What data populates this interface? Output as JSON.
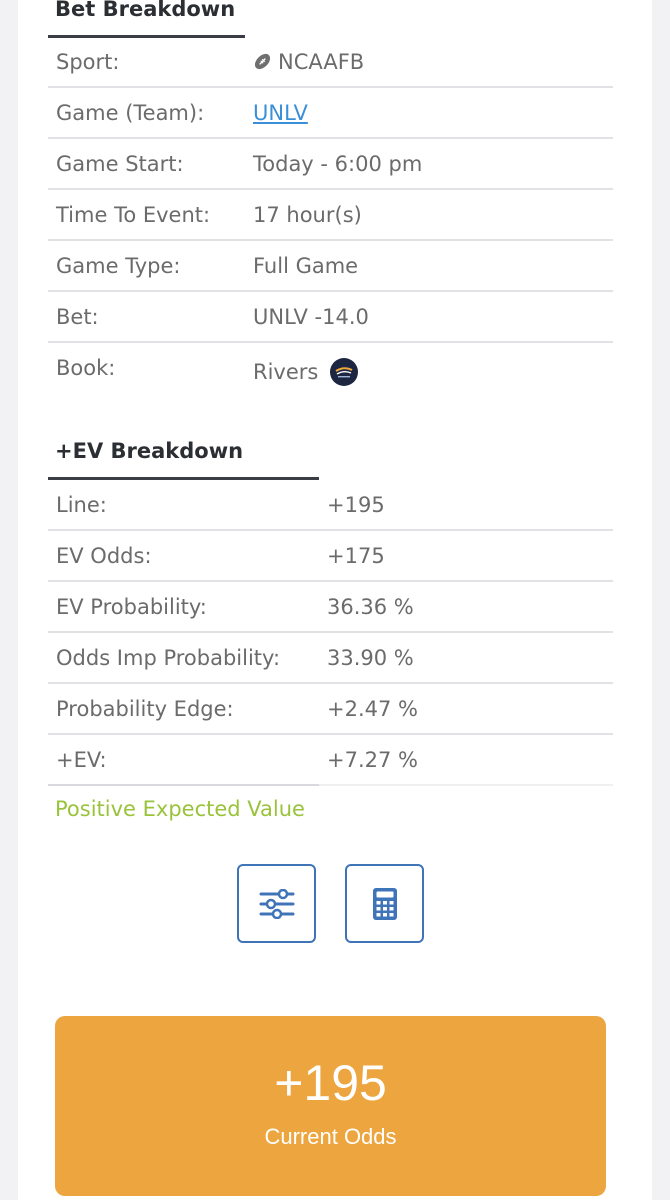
{
  "bet_breakdown": {
    "title": "Bet Breakdown",
    "rows": [
      {
        "label": "Sport:",
        "value": "NCAAFB",
        "icon": "football-icon"
      },
      {
        "label": "Game (Team):",
        "value": "UNLV"
      },
      {
        "label": "Game Start:",
        "value": "Today - 6:00 pm"
      },
      {
        "label": "Time To Event:",
        "value": "17 hour(s)"
      },
      {
        "label": "Game Type:",
        "value": "Full Game"
      },
      {
        "label": "Bet:",
        "value": "UNLV -14.0"
      },
      {
        "label": "Book:",
        "value": "Rivers",
        "icon": "rivers-logo"
      }
    ]
  },
  "ev_breakdown": {
    "title": "+EV Breakdown",
    "rows": [
      {
        "label": "Line:",
        "value": "+195"
      },
      {
        "label": "EV Odds:",
        "value": "+175"
      },
      {
        "label": "EV Probability:",
        "value": "36.36 %"
      },
      {
        "label": "Odds Imp Probability:",
        "value": "33.90 %"
      },
      {
        "label": "Probability Edge:",
        "value": "+2.47 %"
      },
      {
        "label": "+EV:",
        "value": "+7.27 %"
      }
    ],
    "verdict": "Positive Expected Value"
  },
  "actions": {
    "settings_icon": "sliders-icon",
    "calculator_icon": "calculator-icon"
  },
  "odds_card": {
    "value": "+195",
    "caption": "Current Odds"
  },
  "colors": {
    "accent_orange": "#eca53f",
    "positive_green": "#9ac33c",
    "link_blue": "#3a8fd8",
    "button_border": "#3f74b8"
  }
}
